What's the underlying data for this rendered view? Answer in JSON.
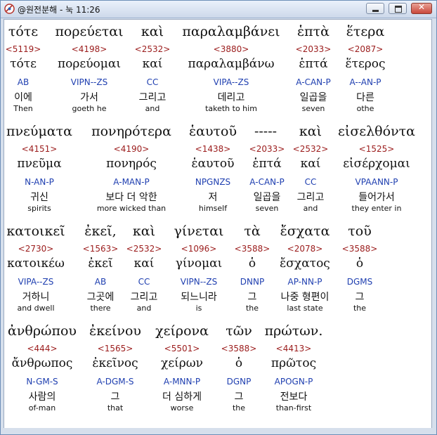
{
  "window": {
    "title": "@원전분해 - 눅 11:26",
    "close_glyph": "✕"
  },
  "rows": [
    {
      "words": [
        {
          "greek": "τότε",
          "strong": "<5119>",
          "lemma": "τότε",
          "parse": "AB",
          "korean": "이에",
          "english": "Then"
        },
        {
          "greek": "πορεύεται",
          "strong": "<4198>",
          "lemma": "πορεύομαι",
          "parse": "VIPN--ZS",
          "korean": "가서",
          "english": "goeth he"
        },
        {
          "greek": "καὶ",
          "strong": "<2532>",
          "lemma": "καί",
          "parse": "CC",
          "korean": "그리고",
          "english": "and"
        },
        {
          "greek": "παραλαμβάνει",
          "strong": "<3880>",
          "lemma": "παραλαμβάνω",
          "parse": "VIPA--ZS",
          "korean": "데리고",
          "english": "taketh to him"
        },
        {
          "greek": "ἑπτὰ",
          "strong": "<2033>",
          "lemma": "ἑπτά",
          "parse": "A-CAN-P",
          "korean": "일곱을",
          "english": "seven"
        },
        {
          "greek": "ἕτερα",
          "strong": "<2087>",
          "lemma": "ἕτερος",
          "parse": "A--AN-P",
          "korean": "다른",
          "english": "othe"
        }
      ]
    },
    {
      "words": [
        {
          "greek": "πνεύματα",
          "strong": "<4151>",
          "lemma": "πνεῦμα",
          "parse": "N-AN-P",
          "korean": "귀신",
          "english": "spirits"
        },
        {
          "greek": "πονηρότερα",
          "strong": "<4190>",
          "lemma": "πονηρός",
          "parse": "A-MAN-P",
          "korean": "보다 더 악한",
          "english": "more wicked than"
        },
        {
          "greek": "ἑαυτοῦ",
          "strong": "<1438>",
          "lemma": "ἑαυτοῦ",
          "parse": "NPGNZS",
          "korean": "저",
          "english": "himself"
        },
        {
          "greek": "-----",
          "strong": "<2033>",
          "lemma": "ἑπτά",
          "parse": "A-CAN-P",
          "korean": "일곱을",
          "english": "seven"
        },
        {
          "greek": "καὶ",
          "strong": "<2532>",
          "lemma": "καί",
          "parse": "CC",
          "korean": "그리고",
          "english": "and"
        },
        {
          "greek": "εἰσελθόντα",
          "strong": "<1525>",
          "lemma": "εἰσέρχομαι",
          "parse": "VPAANN-P",
          "korean": "들어가서",
          "english": "they enter in"
        }
      ]
    },
    {
      "words": [
        {
          "greek": "κατοικεῖ",
          "strong": "<2730>",
          "lemma": "κατοικέω",
          "parse": "VIPA--ZS",
          "korean": "거하니",
          "english": "and dwell"
        },
        {
          "greek": "ἐκεῖ,",
          "strong": "<1563>",
          "lemma": "ἐκεῖ",
          "parse": "AB",
          "korean": "그곳에",
          "english": "there"
        },
        {
          "greek": "καὶ",
          "strong": "<2532>",
          "lemma": "καί",
          "parse": "CC",
          "korean": "그리고",
          "english": "and"
        },
        {
          "greek": "γίνεται",
          "strong": "<1096>",
          "lemma": "γίνομαι",
          "parse": "VIPN--ZS",
          "korean": "되느니라",
          "english": "is"
        },
        {
          "greek": "τὰ",
          "strong": "<3588>",
          "lemma": "ὁ",
          "parse": "DNNP",
          "korean": "그",
          "english": "the"
        },
        {
          "greek": "ἔσχατα",
          "strong": "<2078>",
          "lemma": "ἔσχατος",
          "parse": "AP-NN-P",
          "korean": "나중 형편이",
          "english": "last state"
        },
        {
          "greek": "τοῦ",
          "strong": "<3588>",
          "lemma": "ὁ",
          "parse": "DGMS",
          "korean": "그",
          "english": "the"
        }
      ]
    },
    {
      "words": [
        {
          "greek": "ἀνθρώπου",
          "strong": "<444>",
          "lemma": "ἄνθρωπος",
          "parse": "N-GM-S",
          "korean": "사람의",
          "english": "of-man"
        },
        {
          "greek": "ἐκείνου",
          "strong": "<1565>",
          "lemma": "ἐκεῖνος",
          "parse": "A-DGM-S",
          "korean": "그",
          "english": "that"
        },
        {
          "greek": "χείρονα",
          "strong": "<5501>",
          "lemma": "χείρων",
          "parse": "A-MNN-P",
          "korean": "더 심하게",
          "english": "worse"
        },
        {
          "greek": "τῶν",
          "strong": "<3588>",
          "lemma": "ὁ",
          "parse": "DGNP",
          "korean": "그",
          "english": "the"
        },
        {
          "greek": "πρώτων.",
          "strong": "<4413>",
          "lemma": "πρῶτος",
          "parse": "APOGN-P",
          "korean": "전보다",
          "english": "than-first"
        }
      ]
    }
  ]
}
